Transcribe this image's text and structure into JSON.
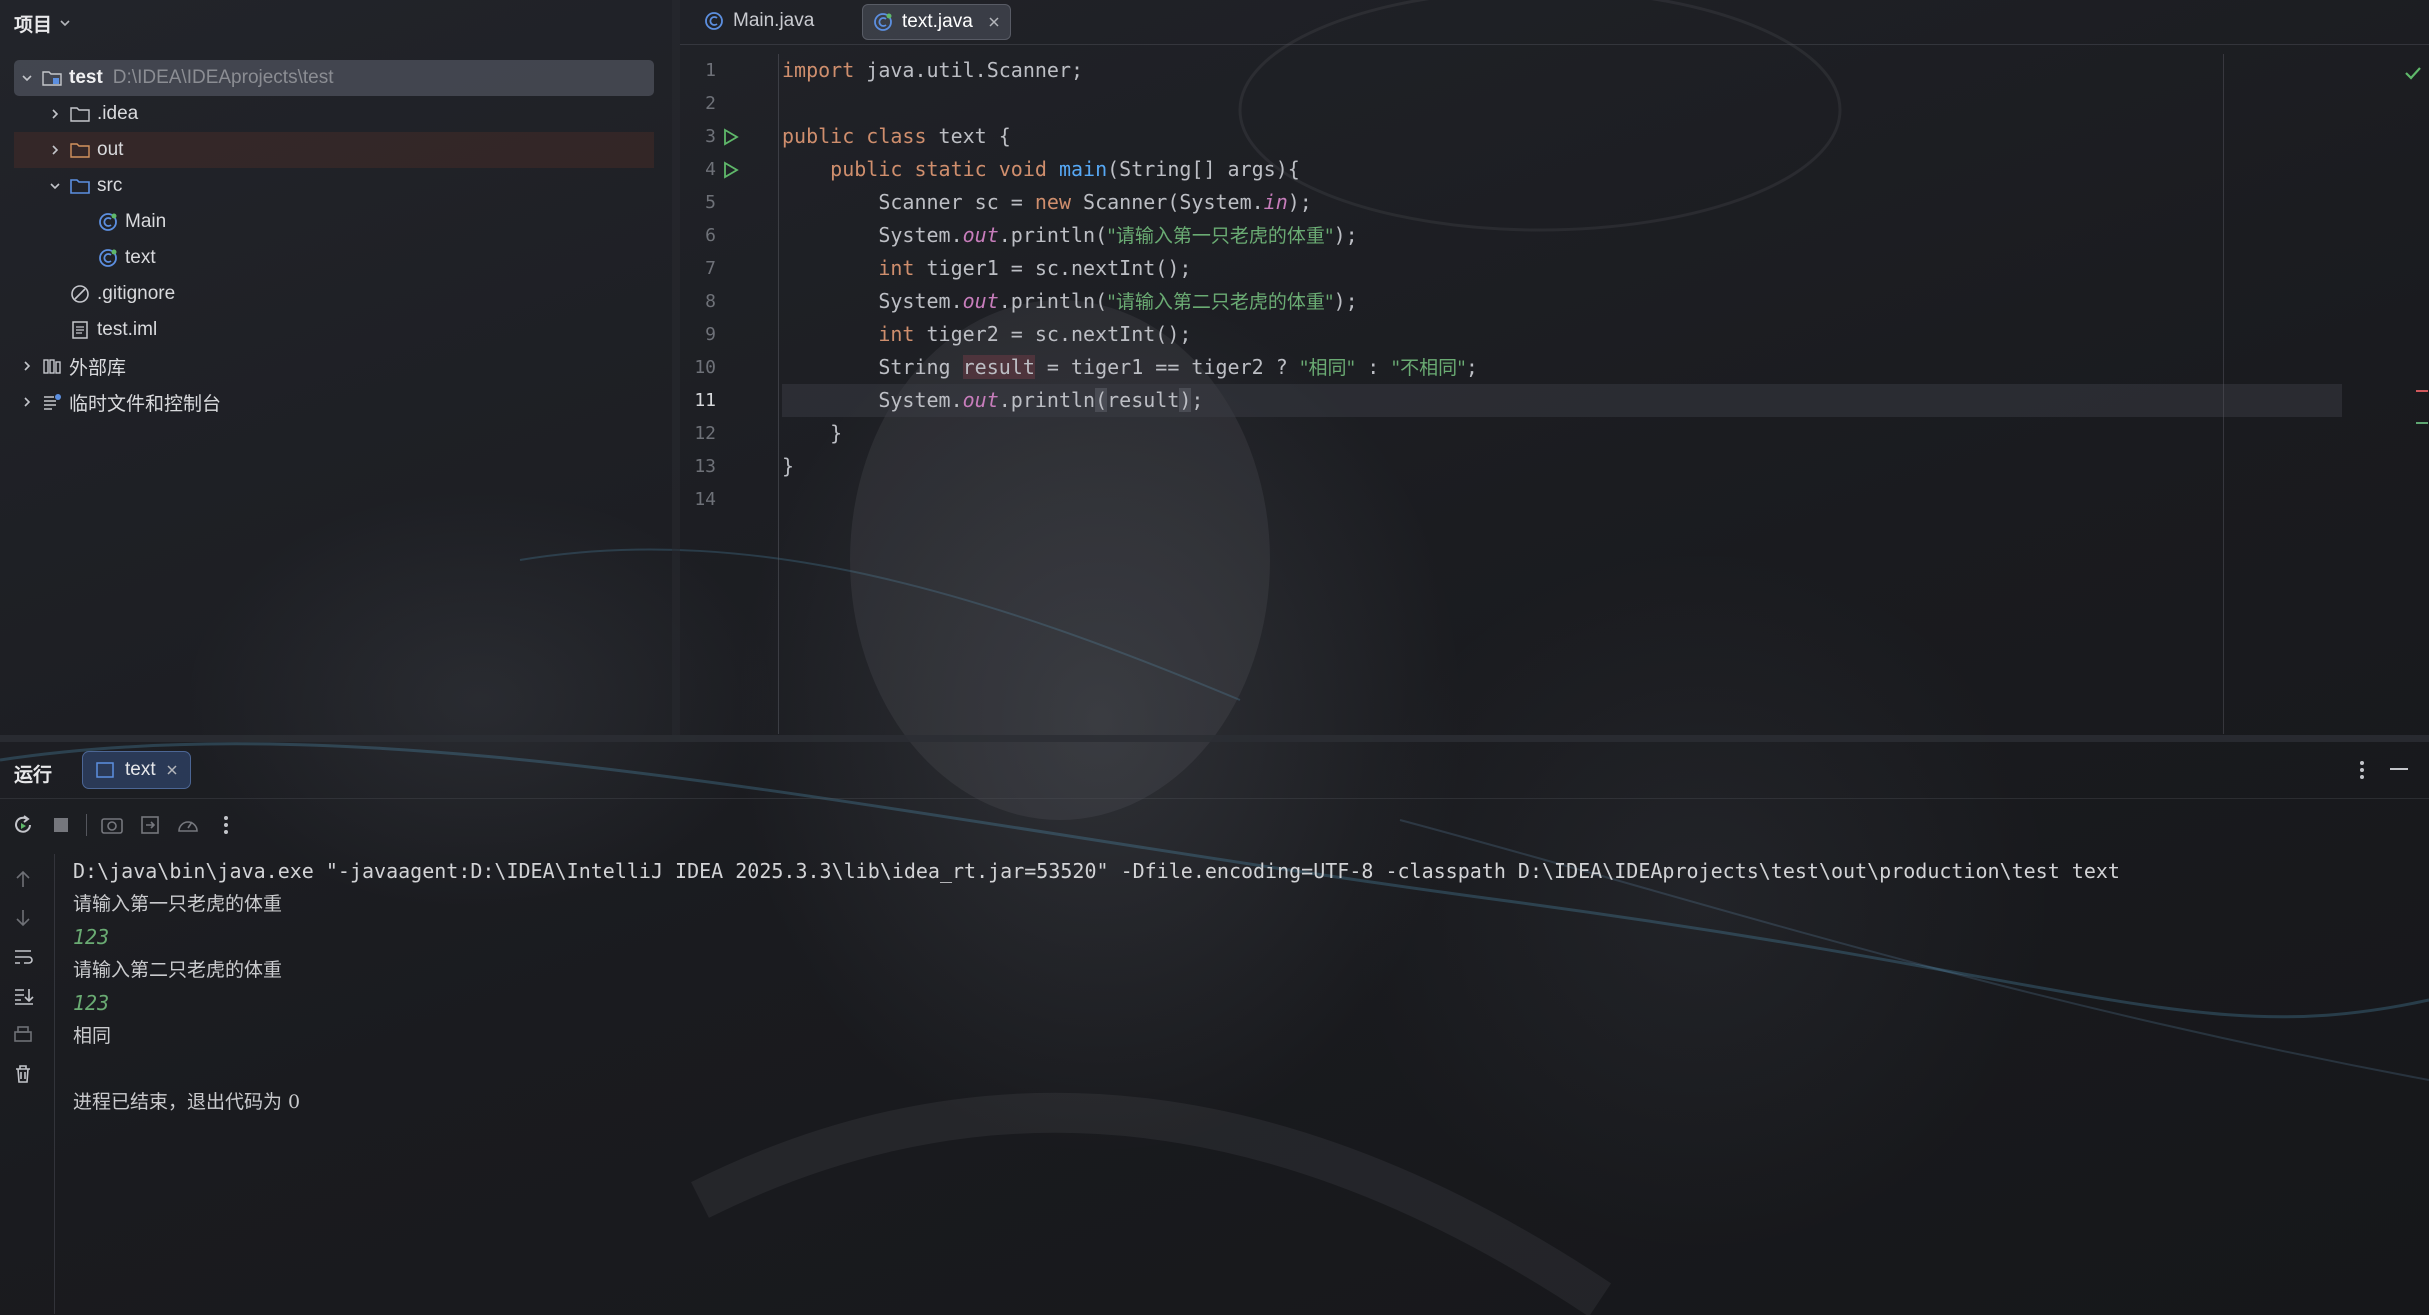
{
  "project_panel": {
    "title": "项目",
    "root": {
      "name": "test",
      "path": "D:\\IDEA\\IDEAprojects\\test"
    },
    "items": [
      {
        "label": ".idea"
      },
      {
        "label": "out"
      },
      {
        "label": "src"
      },
      {
        "label": "Main"
      },
      {
        "label": "text"
      },
      {
        "label": ".gitignore"
      },
      {
        "label": "test.iml"
      },
      {
        "label": "外部库"
      },
      {
        "label": "临时文件和控制台"
      }
    ]
  },
  "editor": {
    "tabs": [
      {
        "label": "Main.java",
        "active": false
      },
      {
        "label": "text.java",
        "active": true
      }
    ],
    "line_numbers": [
      "1",
      "2",
      "3",
      "4",
      "5",
      "6",
      "7",
      "8",
      "9",
      "10",
      "11",
      "12",
      "13",
      "14"
    ],
    "current_line": "11",
    "code": {
      "l1_kw": "import",
      "l1_rest": " java.util.Scanner;",
      "l3_kw": "public class",
      "l3_rest": " text {",
      "l4_kw": "public static void",
      "l4_fn": "main",
      "l4_rest": "(String[] args){",
      "l5_a": "Scanner sc = ",
      "l5_kw": "new",
      "l5_b": " Scanner(System.",
      "l5_it": "in",
      "l5_c": ");",
      "l6_a": "System.",
      "l6_it": "out",
      "l6_b": ".println(",
      "l6_str": "\"请输入第一只老虎的体重\"",
      "l6_c": ");",
      "l7_kw": "int",
      "l7_rest": " tiger1 = sc.nextInt();",
      "l8_a": "System.",
      "l8_it": "out",
      "l8_b": ".println(",
      "l8_str": "\"请输入第二只老虎的体重\"",
      "l8_c": ");",
      "l9_kw": "int",
      "l9_rest": " tiger2 = sc.nextInt();",
      "l10_a": "String ",
      "l10_var": "result",
      "l10_b": " = tiger1 == tiger2 ? ",
      "l10_s1": "\"相同\"",
      "l10_c": " : ",
      "l10_s2": "\"不相同\"",
      "l10_d": ";",
      "l11_a": "System.",
      "l11_it": "out",
      "l11_b": ".println",
      "l11_p1": "(",
      "l11_mid": "result",
      "l11_p2": ")",
      "l11_c": ";",
      "l12": "}",
      "l13": "}"
    }
  },
  "run_panel": {
    "title": "运行",
    "tab_label": "text",
    "console": {
      "command": "D:\\java\\bin\\java.exe \"-javaagent:D:\\IDEA\\IntelliJ IDEA 2025.3.3\\lib\\idea_rt.jar=53520\" -Dfile.encoding=UTF-8 -classpath D:\\IDEA\\IDEAprojects\\test\\out\\production\\test text",
      "prompt1": "请输入第一只老虎的体重",
      "input1": "123",
      "prompt2": "请输入第二只老虎的体重",
      "input2": "123",
      "result": "相同",
      "exit": "进程已结束，退出代码为 0"
    }
  },
  "colors": {
    "keyword": "#cf8e6d",
    "function": "#56a8f5",
    "string": "#6aab73",
    "static_field": "#c77dbb",
    "run_icon": "#5fb86a",
    "accent_blue": "#5c8fe0"
  }
}
